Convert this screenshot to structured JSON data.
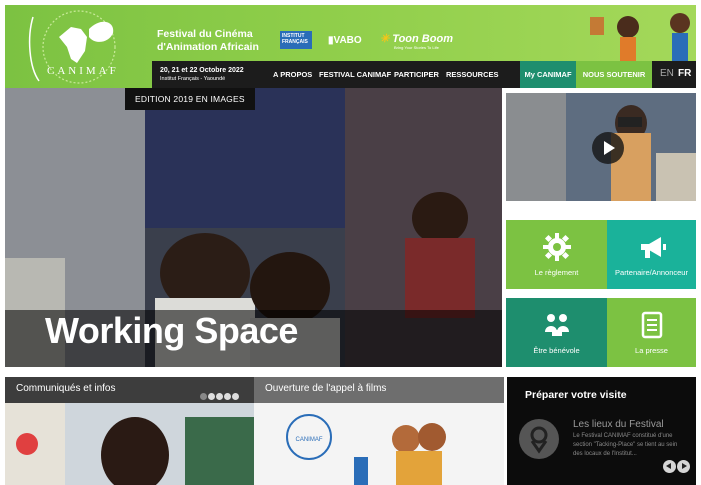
{
  "header": {
    "brand": "CANIMAF",
    "festival_line1": "Festival du Cinéma",
    "festival_line2": "d'Animation Africain",
    "partners": [
      "INSTITUT FRANÇAIS",
      "VABO",
      "Toon Boom"
    ],
    "partner_tagline": "Bring Your Stories To Life"
  },
  "nav": {
    "date_line": "20, 21 et 22 Octobre 2022",
    "venue_line": "Institut Français - Yaoundé",
    "items": [
      "A PROPOS",
      "FESTIVAL CANIMAF",
      "PARTICIPER",
      "RESSOURCES"
    ],
    "my_canimaf": "My CANIMAF",
    "support": "NOUS SOUTENIR",
    "lang_en": "EN",
    "lang_fr": "FR"
  },
  "hero": {
    "tag": "EDITION 2019 EN IMAGES",
    "caption": "Working Space"
  },
  "tiles": [
    {
      "label": "Le règlement",
      "icon": "gear-icon"
    },
    {
      "label": "Partenaire/Annonceur",
      "icon": "megaphone-icon"
    },
    {
      "label": "Être bénévole",
      "icon": "volunteers-icon"
    },
    {
      "label": "La presse",
      "icon": "document-icon"
    }
  ],
  "news": {
    "title": "Communiqués et infos",
    "dots": 5,
    "active_dot": 3
  },
  "call": {
    "title": "Ouverture de l'appel à films"
  },
  "visit": {
    "title": "Préparer votre visite",
    "card_title": "Les lieux du Festival",
    "card_text": "Le Festival CANIMAF constitué d'une section \"Tacking-Place\" se tient au sein des locaux de l'Institut..."
  },
  "colors": {
    "green": "#7cc242",
    "teal": "#1ab29a",
    "dark_teal": "#1e8e6e",
    "navbar": "#1c1c1c"
  }
}
